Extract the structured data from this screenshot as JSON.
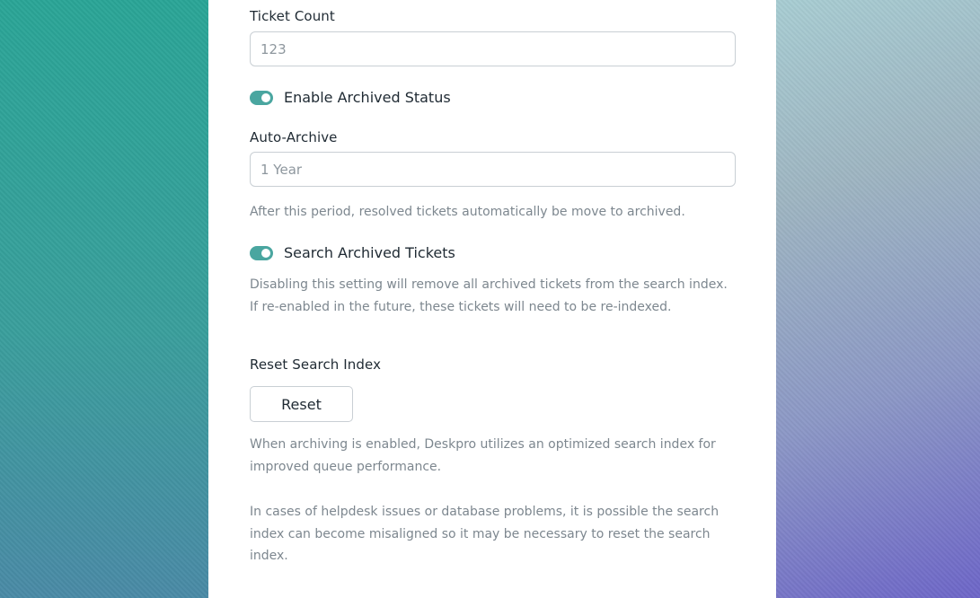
{
  "settings": {
    "ticket_count": {
      "label": "Ticket Count",
      "placeholder": "123",
      "value": ""
    },
    "enable_archived": {
      "label": "Enable Archived Status",
      "enabled": true
    },
    "auto_archive": {
      "label": "Auto-Archive",
      "placeholder": "1 Year",
      "value": "",
      "help": "After this period, resolved tickets automatically be move to archived."
    },
    "search_archived": {
      "label": "Search Archived Tickets",
      "enabled": true,
      "help": "Disabling this setting will remove all archived tickets from the search index. If re-enabled in the future, these tickets will need to be re-indexed."
    },
    "reset_index": {
      "label": "Reset Search Index",
      "button_label": "Reset",
      "help_1": "When archiving is enabled, Deskpro utilizes an optimized search index for improved queue performance.",
      "help_2": "In cases of helpdesk issues or database problems, it is possible the search index can become misaligned so it may be necessary to reset the search index."
    }
  },
  "colors": {
    "toggle_on": "#4aa6a0",
    "text_primary": "#1f2a33",
    "text_muted": "#7d878f",
    "border": "#c9cfd4"
  }
}
